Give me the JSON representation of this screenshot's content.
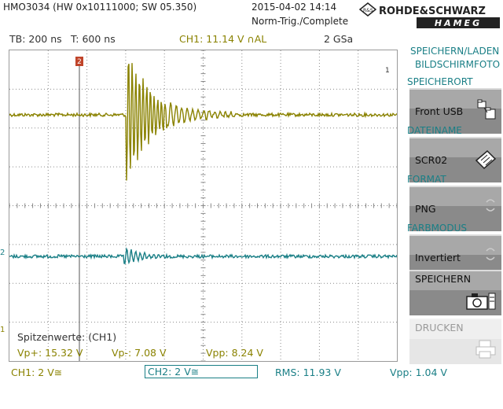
{
  "header": {
    "model": "HMO3034 (HW 0x10111000; SW 05.350)",
    "datetime": "2015-04-02 14:14",
    "trigger_mode": "Norm-Trig./Complete",
    "brand_top": "ROHDE&SCHWARZ",
    "brand_bottom": "HAMEG"
  },
  "status": {
    "timebase": "TB: 200 ns",
    "trigger_pos": "T: 600 ns",
    "ch1_trigger": "CH1: 11.14 V ∩AL",
    "sample_rate": "2 GSa"
  },
  "markers": {
    "trigger_marker": "2",
    "ch2_marker": "2",
    "ch1_marker": "1",
    "ch1_level_marker": "1"
  },
  "measurement": {
    "title": "Spitzenwerte: (CH1)",
    "vp_plus": "Vp+: 15.32 V",
    "vp_minus": "Vp-: 7.08 V",
    "vpp": "Vpp: 8.24 V"
  },
  "footer": {
    "ch1_scale": "CH1: 2 V≅",
    "ch2_scale": "CH2: 2 V≅",
    "rms": "RMS: 11.93 V",
    "vpp": "Vpp: 1.04 V"
  },
  "menu": {
    "title_line1": "SPEICHERN/LADEN",
    "title_line2": "BILDSCHIRMFOTO",
    "sections": [
      {
        "heading": "SPEICHERORT",
        "value": "Front USB"
      },
      {
        "heading": "DATEINAME",
        "value": "SCR02"
      },
      {
        "heading": "FORMAT",
        "value": "PNG"
      },
      {
        "heading": "FARBMODUS",
        "value": "Invertiert"
      }
    ],
    "save_label": "SPEICHERN",
    "print_label": "DRUCKEN"
  },
  "colors": {
    "ch1": "#8a8200",
    "ch2": "#1a7f86",
    "grid": "#8a8a8a"
  }
}
